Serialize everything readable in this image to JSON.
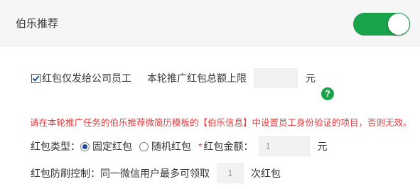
{
  "header": {
    "title": "伯乐推荐",
    "toggle_on": true
  },
  "staff_only": {
    "checked": true,
    "label": "红包仅发给公司员工"
  },
  "budget": {
    "label": "本轮推广红包总额上限",
    "value": "",
    "unit": "元"
  },
  "help_icon": "?",
  "warning": "请在本轮推广任务的伯乐推荐微简历模板的【伯乐信息】中设置员工身份验证的项目，否则无效。",
  "red_packet": {
    "type_label": "红包类型：",
    "options": [
      "固定红包",
      "随机红包"
    ],
    "selected": "固定红包",
    "amount_required_mark": "*",
    "amount_label": "红包金额：",
    "amount_value": "1",
    "amount_unit": "元"
  },
  "anti_fraud": {
    "label": "红包防刷控制：同一微信用户最多可领取",
    "value": "1",
    "unit": "次红包"
  },
  "colors": {
    "accent": "#1aa34a",
    "warning": "#e4393c"
  }
}
